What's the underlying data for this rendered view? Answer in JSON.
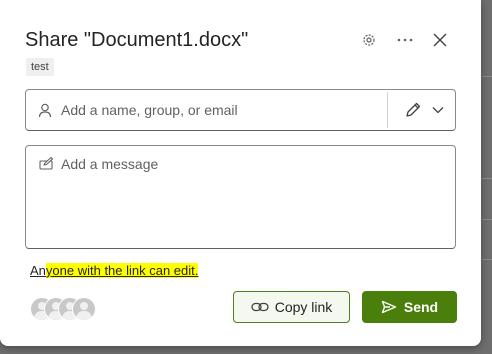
{
  "dialog": {
    "title": "Share \"Document1.docx\"",
    "tag": "test",
    "header_icons": [
      "gear-icon",
      "more-icon",
      "close-icon"
    ]
  },
  "people_input": {
    "placeholder": "Add a name, group, or email",
    "value": "",
    "permission_icon": "pencil-icon"
  },
  "message": {
    "placeholder": "Add a message",
    "value": ""
  },
  "link_setting": {
    "prefix": "An",
    "highlighted": "yone with the link can edit."
  },
  "actions": {
    "copy_link_label": "Copy link",
    "send_label": "Send"
  },
  "colors": {
    "accent": "#4a7f0c",
    "highlight": "#ffff00"
  }
}
